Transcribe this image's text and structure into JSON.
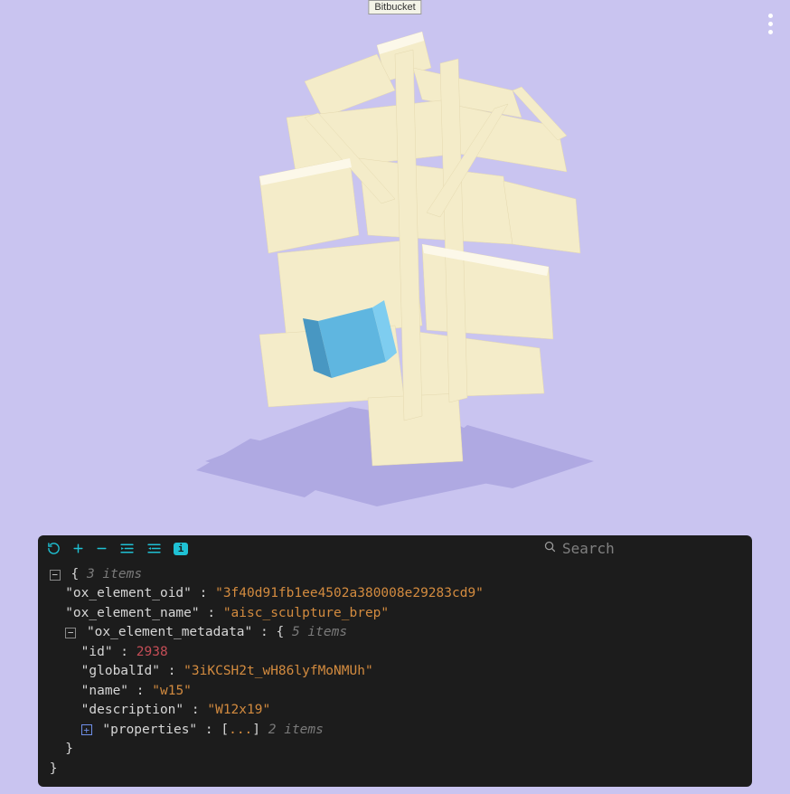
{
  "tooltip": "Bitbucket",
  "search": {
    "placeholder": "Search"
  },
  "json": {
    "root_count_label": "3 items",
    "ox_element_oid_key": "\"ox_element_oid\"",
    "ox_element_oid_val": "\"3f40d91fb1ee4502a380008e29283cd9\"",
    "ox_element_name_key": "\"ox_element_name\"",
    "ox_element_name_val": "\"aisc_sculpture_brep\"",
    "ox_element_metadata_key": "\"ox_element_metadata\"",
    "metadata_count_label": "5 items",
    "meta_id_key": "\"id\"",
    "meta_id_val": "2938",
    "meta_globalId_key": "\"globalId\"",
    "meta_globalId_val": "\"3iKCSH2t_wH86lyfMoNMUh\"",
    "meta_name_key": "\"name\"",
    "meta_name_val": "\"w15\"",
    "meta_description_key": "\"description\"",
    "meta_description_val": "\"W12x19\"",
    "meta_properties_key": "\"properties\"",
    "properties_count_label": "2 items",
    "ellipsis": "...",
    "colon": " : ",
    "colonb": ": ",
    "brace_open": "{",
    "brace_close": "}",
    "bracket_open": "[",
    "bracket_close": "]"
  }
}
